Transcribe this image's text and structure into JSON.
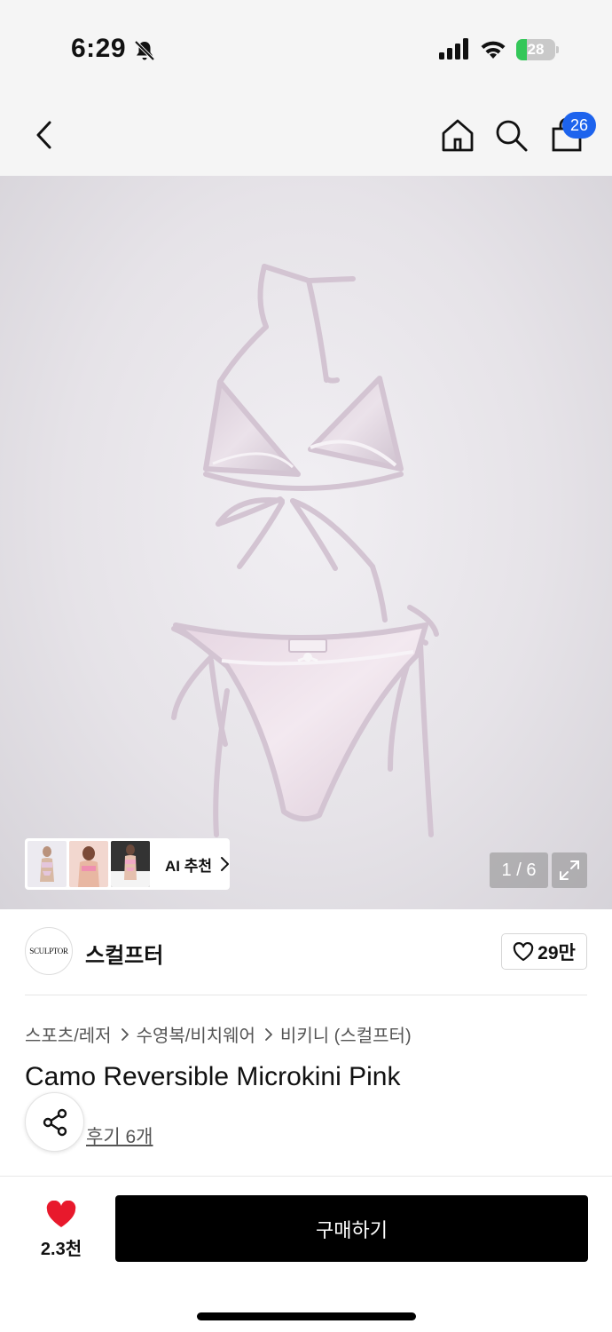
{
  "status_bar": {
    "time": "6:29",
    "battery_text": "28",
    "battery_level": 0.28,
    "icons": [
      "bell-off-icon",
      "signal-icon",
      "wifi-icon",
      "battery-icon"
    ]
  },
  "nav": {
    "icons": [
      "back-arrow-icon",
      "home-icon",
      "search-icon",
      "shopping-bag-icon"
    ],
    "cart_badge": "26"
  },
  "gallery": {
    "ai_recommend_label": "AI 추천",
    "page_counter": "1 / 6",
    "expand_icon": "expand-icon"
  },
  "brand": {
    "logo_text": "SCULPTOR",
    "name": "스컬프터",
    "like_count": "29만"
  },
  "breadcrumb": [
    "스포츠/레저",
    "수영복/비치웨어",
    "비키니 (스컬프터)"
  ],
  "product": {
    "title": "Camo Reversible Microkini Pink",
    "reviews_link": "후기 6개"
  },
  "bottom_bar": {
    "wish_count": "2.3천",
    "buy_label": "구매하기"
  },
  "colors": {
    "badge": "#1d63ed",
    "heart": "#e8192c",
    "buy_button": "#000000",
    "battery": "#34c759"
  }
}
